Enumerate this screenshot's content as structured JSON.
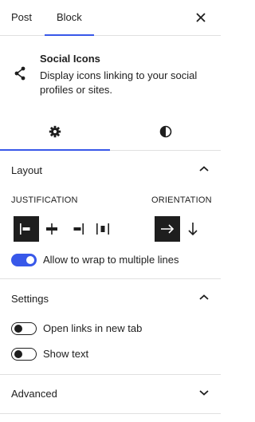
{
  "tabs": {
    "post": "Post",
    "block": "Block"
  },
  "block_card": {
    "icon": "share-icon",
    "title": "Social Icons",
    "description": "Display icons linking to your social profiles or sites."
  },
  "subtabs": {
    "settings_icon": "gear-icon",
    "styles_icon": "contrast-icon"
  },
  "layout": {
    "title": "Layout",
    "justification_label": "JUSTIFICATION",
    "orientation_label": "ORIENTATION",
    "justification_options": [
      "left",
      "center",
      "right",
      "space-between"
    ],
    "justification_selected": "left",
    "orientation_options": [
      "horizontal",
      "vertical"
    ],
    "orientation_selected": "horizontal",
    "wrap_label": "Allow to wrap to multiple lines",
    "wrap_on": true
  },
  "settings": {
    "title": "Settings",
    "new_tab_label": "Open links in new tab",
    "new_tab_on": false,
    "show_text_label": "Show text",
    "show_text_on": false
  },
  "advanced": {
    "title": "Advanced"
  },
  "colors": {
    "accent": "#3858e9",
    "dark": "#1e1e1e",
    "border": "#e0e0e0"
  }
}
